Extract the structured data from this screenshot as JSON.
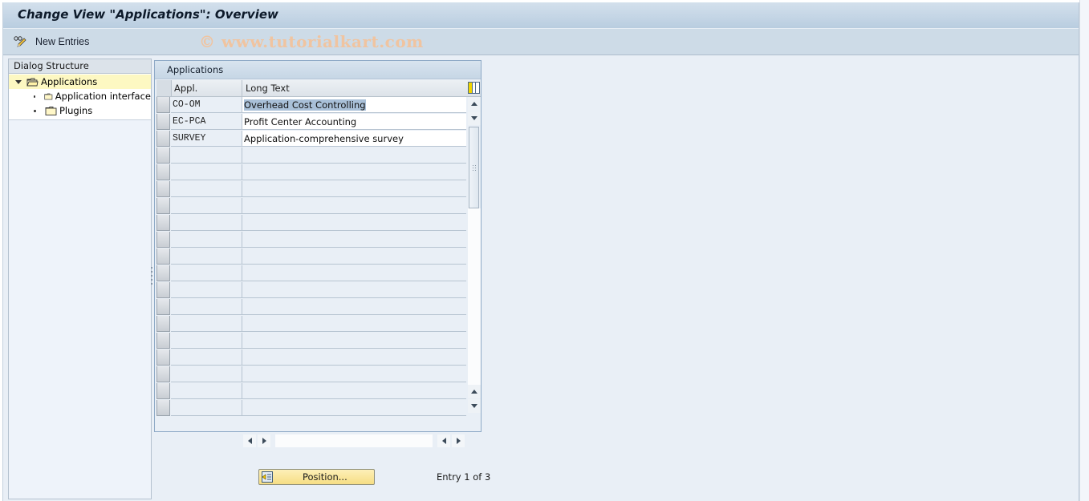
{
  "window": {
    "title": "Change View \"Applications\": Overview"
  },
  "toolbar": {
    "new_entries_label": "New Entries",
    "new_entries_icon": "pencil-glasses-icon"
  },
  "watermark": "© www.tutorialkart.com",
  "dialog_structure": {
    "header": "Dialog Structure",
    "items": [
      {
        "label": "Applications",
        "level": 0,
        "expanded": true,
        "selected": true,
        "icon": "open-folder-icon"
      },
      {
        "label": "Application interface",
        "level": 1,
        "selected": false,
        "icon": "folder-icon"
      },
      {
        "label": "Plugins",
        "level": 1,
        "selected": false,
        "icon": "folder-icon"
      }
    ]
  },
  "table": {
    "title": "Applications",
    "columns": [
      "Appl.",
      "Long Text"
    ],
    "rows": [
      {
        "appl": "CO-OM",
        "long_text": "Overhead Cost Controlling",
        "highlighted": true
      },
      {
        "appl": "EC-PCA",
        "long_text": "Profit Center Accounting",
        "highlighted": false
      },
      {
        "appl": "SURVEY",
        "long_text": "Application-comprehensive survey",
        "highlighted": false
      }
    ],
    "empty_rows": 16
  },
  "footer": {
    "position_button_label": "Position...",
    "entry_status": "Entry 1 of 3"
  },
  "colors": {
    "selection_highlight": "#a9c0d8",
    "tree_selected_bg": "#fdf8c2",
    "position_button_bg": "#f6de84",
    "background": "#e9eff6"
  }
}
